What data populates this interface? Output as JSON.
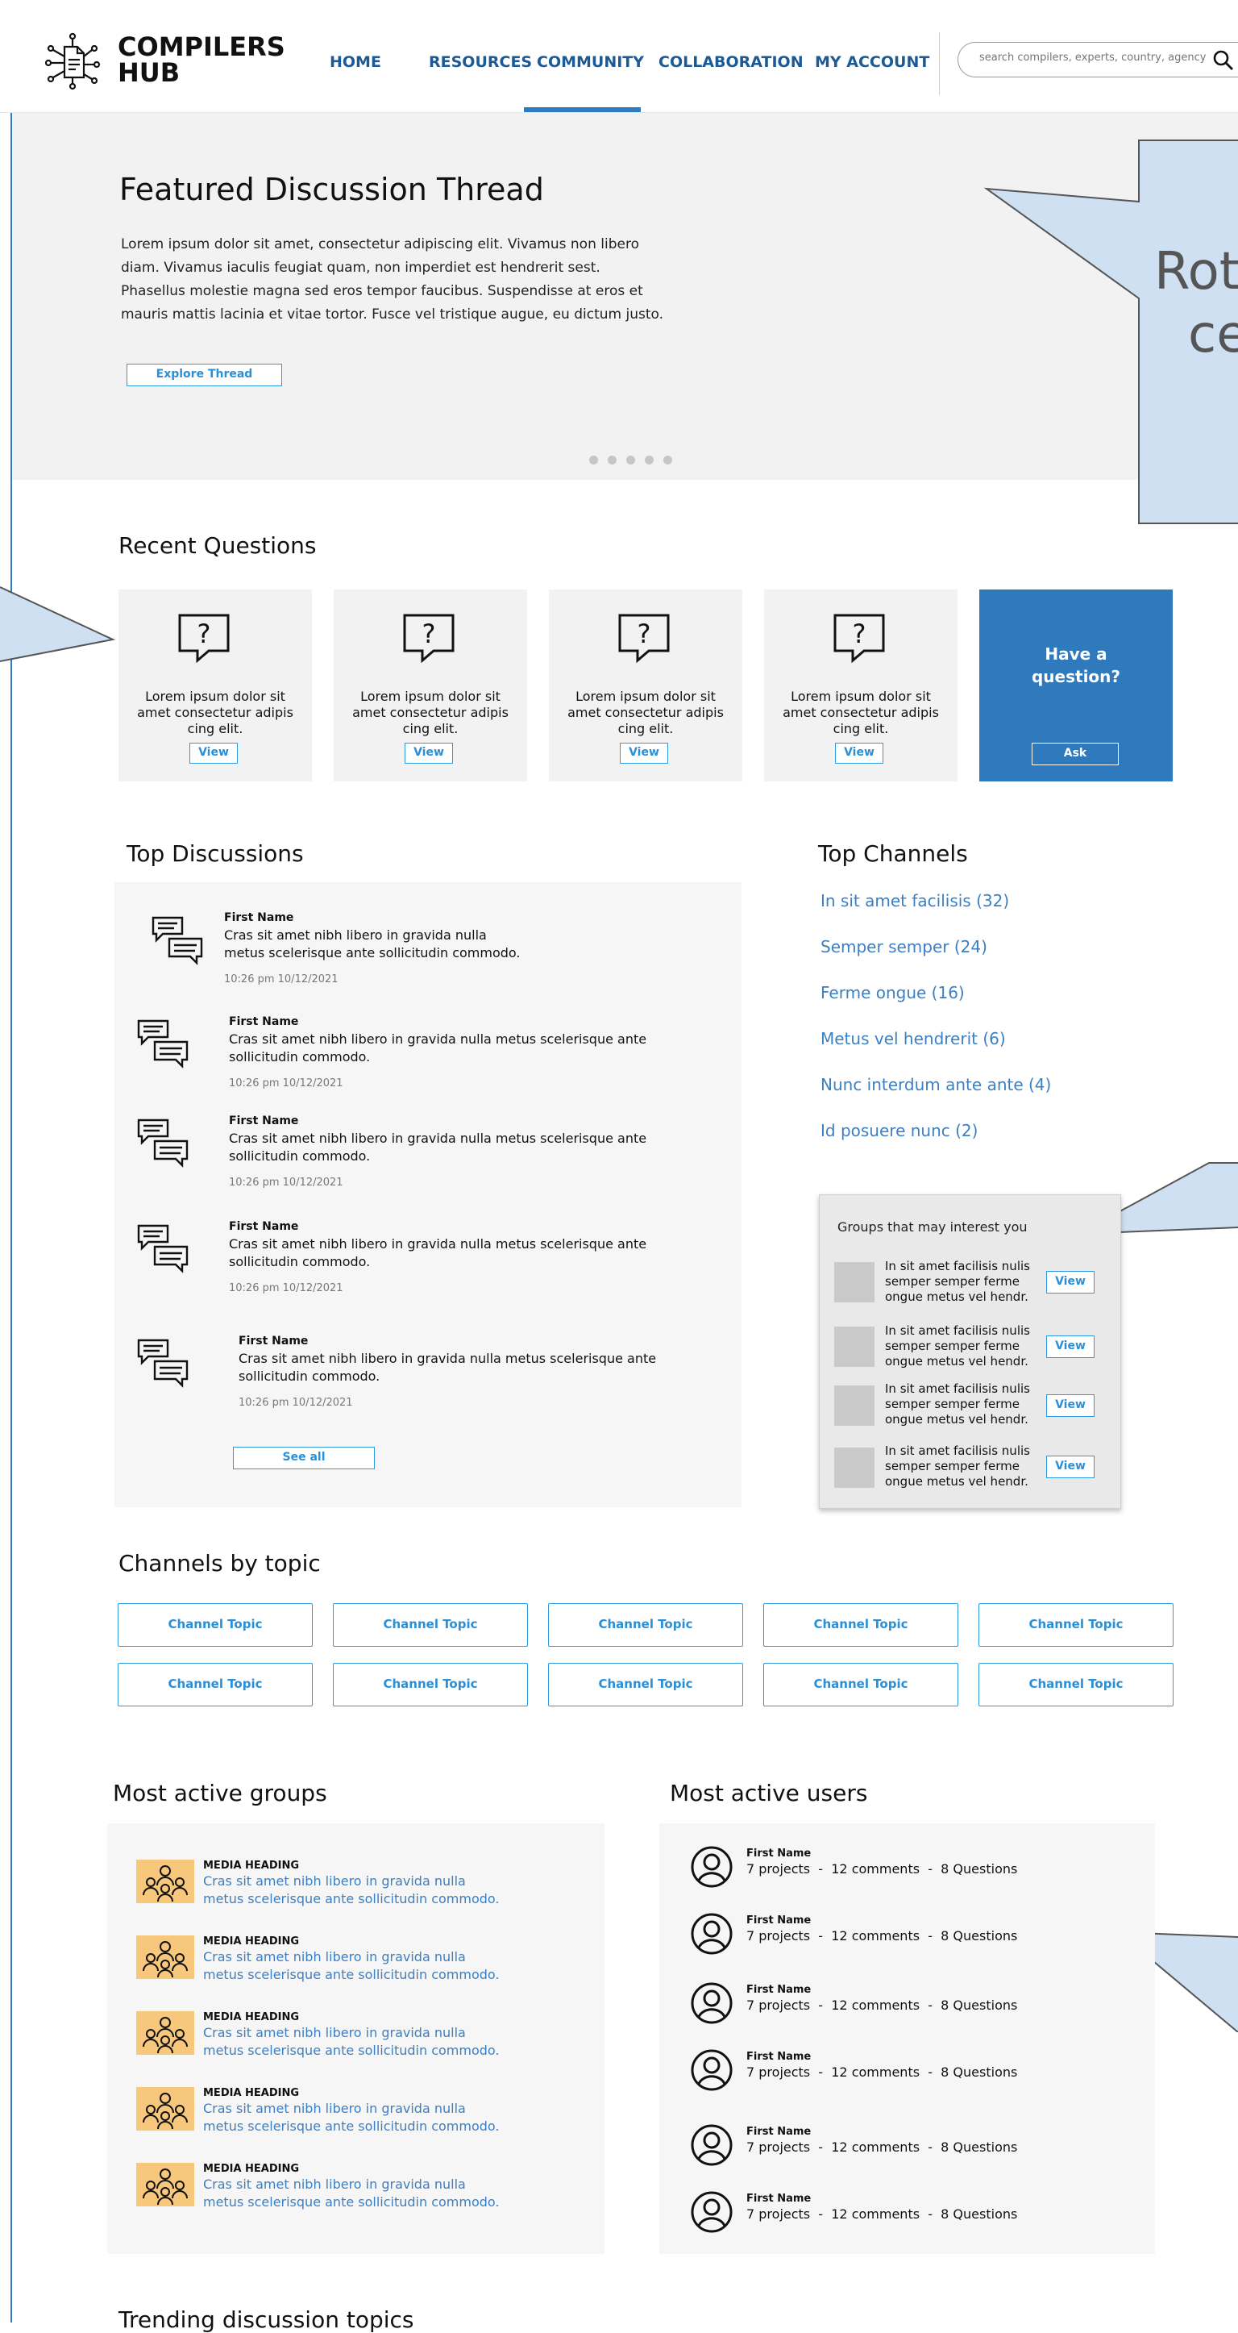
{
  "header": {
    "logo_line1": "COMPILERS",
    "logo_line2": "HUB",
    "nav": [
      "HOME",
      "RESOURCES",
      "COMMUNITY",
      "COLLABORATION",
      "MY ACCOUNT"
    ],
    "active_nav": "COMMUNITY",
    "search_placeholder": "search compilers, experts, country, agency"
  },
  "hero": {
    "title": "Featured Discussion Thread",
    "text": "Lorem ipsum dolor sit amet, consectetur adipiscing elit. Vivamus non libero diam. Vivamus iaculis feugiat quam, non imperdiet est hendrerit sest. Phasellus molestie magna sed eros tempor faucibus. Suspendisse at eros et mauris mattis lacinia et vitae tortor. Fusce vel tristique augue, eu dictum justo.",
    "button": "Explore Thread",
    "dots": 5
  },
  "callouts": {
    "hero_text_line1": "Rota",
    "hero_text_line2": "ce"
  },
  "recent_questions": {
    "title": "Recent Questions",
    "cards": [
      {
        "text": "Lorem ipsum dolor sit amet consectetur adipis cing elit.",
        "button": "View"
      },
      {
        "text": "Lorem ipsum dolor sit amet consectetur adipis cing elit.",
        "button": "View"
      },
      {
        "text": "Lorem ipsum dolor sit amet consectetur adipis cing elit.",
        "button": "View"
      },
      {
        "text": "Lorem ipsum dolor sit amet consectetur adipis cing elit.",
        "button": "View"
      }
    ],
    "ask_title": "Have a question?",
    "ask_button": "Ask"
  },
  "top_discussions": {
    "title": "Top Discussions",
    "items": [
      {
        "name": "First Name",
        "text": "Cras sit amet nibh libero in gravida nulla metus scelerisque ante sollicitudin commodo.",
        "time": "10:26 pm 10/12/2021"
      },
      {
        "name": "First Name",
        "text": "Cras sit amet nibh libero in gravida nulla metus scelerisque ante sollicitudin commodo.",
        "time": "10:26 pm 10/12/2021"
      },
      {
        "name": "First Name",
        "text": "Cras sit amet nibh libero in gravida nulla metus scelerisque ante sollicitudin commodo.",
        "time": "10:26 pm 10/12/2021"
      },
      {
        "name": "First Name",
        "text": "Cras sit amet nibh libero in gravida nulla metus scelerisque ante sollicitudin commodo.",
        "time": "10:26 pm 10/12/2021"
      },
      {
        "name": "First Name",
        "text": "Cras sit amet nibh libero in gravida nulla metus scelerisque ante sollicitudin commodo.",
        "time": "10:26 pm 10/12/2021"
      }
    ],
    "see_all": "See all"
  },
  "top_channels": {
    "title": "Top Channels",
    "links": [
      "In sit amet facilisis (32)",
      "Semper semper (24)",
      "Ferme ongue (16)",
      "Metus vel hendrerit (6)",
      "Nunc interdum ante ante (4)",
      "Id posuere nunc (2)"
    ]
  },
  "groups_interest": {
    "title": "Groups that may interest you",
    "items": [
      {
        "text": "In sit amet facilisis nulis semper semper ferme ongue metus vel hendr.",
        "button": "View"
      },
      {
        "text": "In sit amet facilisis nulis semper semper ferme ongue metus vel hendr.",
        "button": "View"
      },
      {
        "text": "In sit amet facilisis nulis semper semper ferme ongue metus vel hendr.",
        "button": "View"
      },
      {
        "text": "In sit amet facilisis nulis semper semper ferme ongue metus vel hendr.",
        "button": "View"
      }
    ]
  },
  "channels_by_topic": {
    "title": "Channels by topic",
    "buttons": [
      "Channel Topic",
      "Channel Topic",
      "Channel Topic",
      "Channel Topic",
      "Channel Topic",
      "Channel Topic",
      "Channel Topic",
      "Channel Topic",
      "Channel Topic",
      "Channel Topic"
    ]
  },
  "most_active_groups": {
    "title": "Most active groups",
    "items": [
      {
        "heading": "MEDIA HEADING",
        "text": "Cras sit amet nibh libero in gravida nulla metus scelerisque ante sollicitudin commodo."
      },
      {
        "heading": "MEDIA HEADING",
        "text": "Cras sit amet nibh libero in gravida nulla metus scelerisque ante sollicitudin commodo."
      },
      {
        "heading": "MEDIA HEADING",
        "text": "Cras sit amet nibh libero in gravida nulla metus scelerisque ante sollicitudin commodo."
      },
      {
        "heading": "MEDIA HEADING",
        "text": "Cras sit amet nibh libero in gravida nulla metus scelerisque ante sollicitudin commodo."
      },
      {
        "heading": "MEDIA HEADING",
        "text": "Cras sit amet nibh libero in gravida nulla metus scelerisque ante sollicitudin commodo."
      }
    ]
  },
  "most_active_users": {
    "title": "Most active users",
    "items": [
      {
        "name": "First Name",
        "stats": "7 projects  -  12 comments  -  8 Questions"
      },
      {
        "name": "First Name",
        "stats": "7 projects  -  12 comments  -  8 Questions"
      },
      {
        "name": "First Name",
        "stats": "7 projects  -  12 comments  -  8 Questions"
      },
      {
        "name": "First Name",
        "stats": "7 projects  -  12 comments  -  8 Questions"
      },
      {
        "name": "First Name",
        "stats": "7 projects  -  12 comments  -  8 Questions"
      },
      {
        "name": "First Name",
        "stats": "7 projects  -  12 comments  -  8 Questions"
      }
    ]
  },
  "trending": {
    "title": "Trending discussion topics"
  },
  "colors": {
    "accent_blue": "#2f79bd",
    "link_blue": "#3b7fc4",
    "callout_fill": "#cfe0f3",
    "group_thumb": "#f7c77c"
  }
}
